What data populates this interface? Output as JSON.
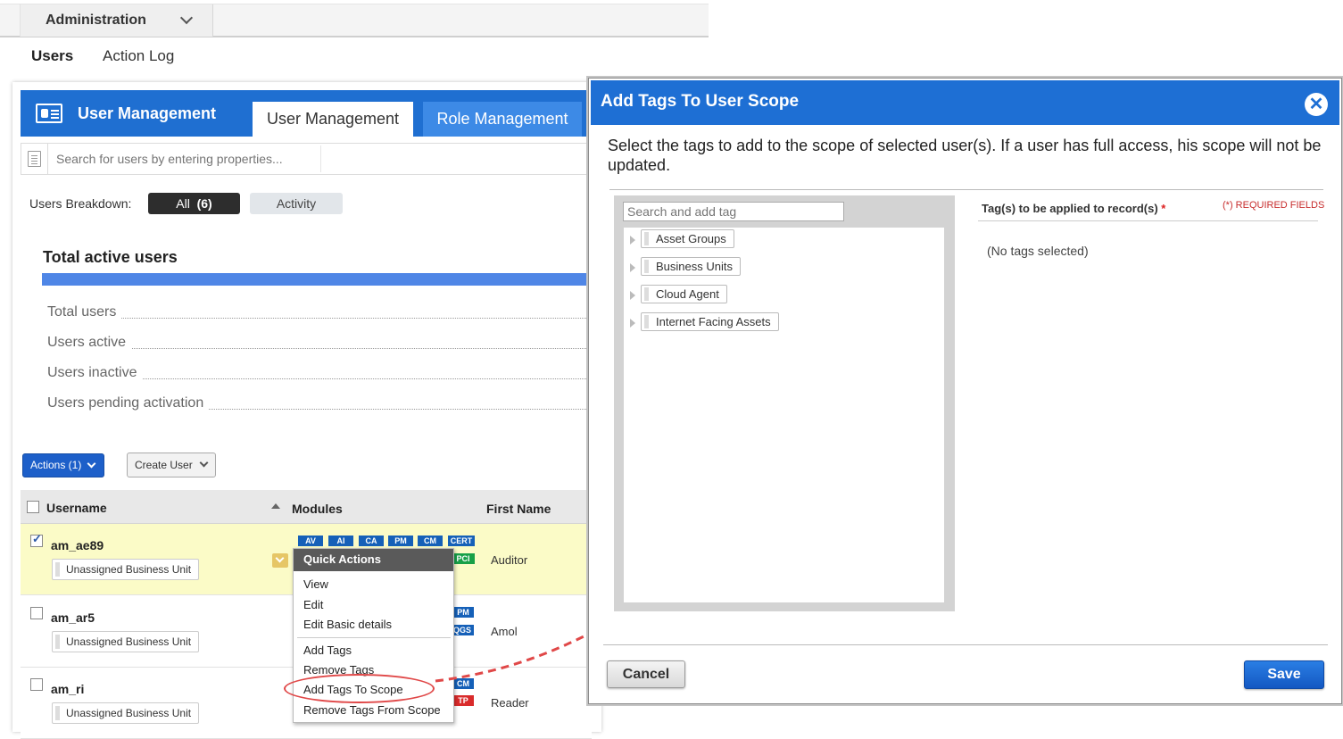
{
  "admin_bar": {
    "dropdown_label": "Administration"
  },
  "top_tabs": {
    "users": "Users",
    "action_log": "Action Log"
  },
  "user_management": {
    "title": "User Management",
    "tabs": [
      "User Management",
      "Role Management"
    ],
    "search_placeholder": "Search for users by entering properties...",
    "breakdown_label": "Users Breakdown:",
    "breakdown_all": "All",
    "breakdown_all_count": "(6)",
    "breakdown_activity": "Activity",
    "summary_title": "Total active users",
    "stats": [
      "Total users",
      "Users active",
      "Users inactive",
      "Users pending activation"
    ],
    "actions_button": "Actions (1)",
    "create_user_button": "Create User",
    "table": {
      "headers": [
        "Username",
        "Modules",
        "First Name"
      ],
      "rows": [
        {
          "username": "am_ae89",
          "business_unit": "Unassigned Business Unit",
          "first_name": "Auditor",
          "selected": true
        },
        {
          "username": "am_ar5",
          "business_unit": "Unassigned Business Unit",
          "first_name": "Amol",
          "selected": false
        },
        {
          "username": "am_ri",
          "business_unit": "Unassigned Business Unit",
          "first_name": "Reader",
          "selected": false
        }
      ],
      "row1_modules": [
        "AV",
        "AI",
        "CA",
        "PM",
        "CM",
        "CERT"
      ],
      "row1_modules_line2": [
        "PCI"
      ],
      "row2_modules": [
        "PM",
        "QGS"
      ],
      "row3_modules": [
        "CM",
        "TP"
      ]
    },
    "quick_actions": {
      "title": "Quick Actions",
      "group1": [
        "View",
        "Edit",
        "Edit Basic details"
      ],
      "group2": [
        "Add Tags",
        "Remove Tags",
        "Add Tags To Scope",
        "Remove Tags From Scope"
      ]
    }
  },
  "modal": {
    "title": "Add Tags To User Scope",
    "close_icon": "close-icon",
    "description": "Select the tags to add to the scope of selected user(s). If a user has full access, his scope will not be updated.",
    "tag_search_placeholder": "Search and add tag",
    "tags": [
      "Asset Groups",
      "Business Units",
      "Cloud Agent",
      "Internet Facing Assets"
    ],
    "applied_label": "Tag(s) to be applied to record(s)",
    "required_star": "*",
    "required_note": "(*) REQUIRED FIELDS",
    "no_tags": "(No tags selected)",
    "cancel": "Cancel",
    "save": "Save"
  },
  "colors": {
    "header_blue": "#1f6fd1",
    "selected_row": "#fbfbc7",
    "highlight_red": "#e04848"
  }
}
